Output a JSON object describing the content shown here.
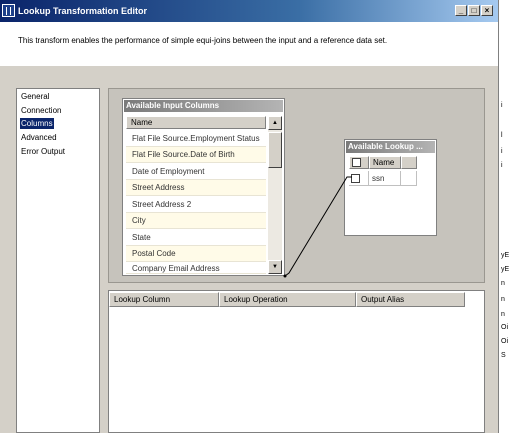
{
  "window": {
    "title": "Lookup Transformation Editor",
    "buttons": {
      "minimize": "_",
      "maximize": "□",
      "close": "×"
    },
    "description": "This transform enables the performance of simple equi-joins between the input and a reference data set."
  },
  "nav": {
    "items": [
      {
        "label": "General",
        "selected": false
      },
      {
        "label": "Connection",
        "selected": false
      },
      {
        "label": "Columns",
        "selected": true
      },
      {
        "label": "Advanced",
        "selected": false
      },
      {
        "label": "Error Output",
        "selected": false
      }
    ]
  },
  "input_columns": {
    "title": "Available Input Columns",
    "header": "Name",
    "rows": [
      "Flat File Source.Employment Status",
      "Flat File Source.Date of Birth",
      "Date of Employment",
      "Street Address",
      "Street Address 2",
      "City",
      "State",
      "Postal Code",
      "Company Email Address"
    ]
  },
  "lookup_columns": {
    "title": "Available Lookup ...",
    "header": "Name",
    "rows": [
      {
        "name": "ssn"
      }
    ]
  },
  "grid": {
    "columns": [
      "Lookup Column",
      "Lookup Operation",
      "Output Alias"
    ]
  },
  "background_strip": {
    "fragments": [
      "i",
      "l",
      "i",
      "i",
      "yE",
      "yE",
      "n",
      "n",
      "n",
      "Oi",
      "Oi",
      "S"
    ]
  }
}
